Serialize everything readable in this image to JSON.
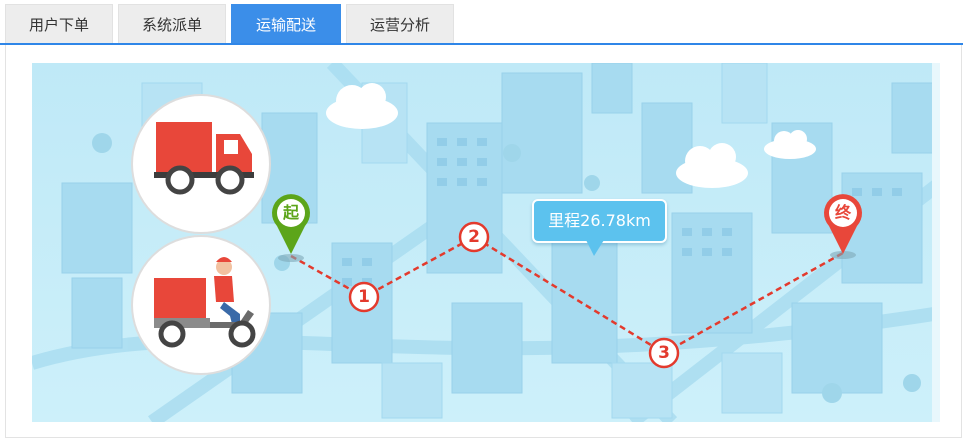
{
  "tabs": [
    {
      "label": "用户下单",
      "active": false
    },
    {
      "label": "系统派单",
      "active": false
    },
    {
      "label": "运输配送",
      "active": true
    },
    {
      "label": "运营分析",
      "active": false
    }
  ],
  "route": {
    "start_marker": "起",
    "end_marker": "终",
    "steps": [
      "1",
      "2",
      "3"
    ],
    "mileage_label": "里程26.78km"
  },
  "icons": {
    "truck": "truck-icon",
    "scooter": "delivery-scooter-icon"
  },
  "colors": {
    "tab_active": "#3b8ee9",
    "route_line": "#e33a2d",
    "start_pin": "#5ca51a",
    "end_pin": "#e8473a",
    "mileage_bubble": "#5cc2ee",
    "map_background": "#c6ecf8"
  }
}
